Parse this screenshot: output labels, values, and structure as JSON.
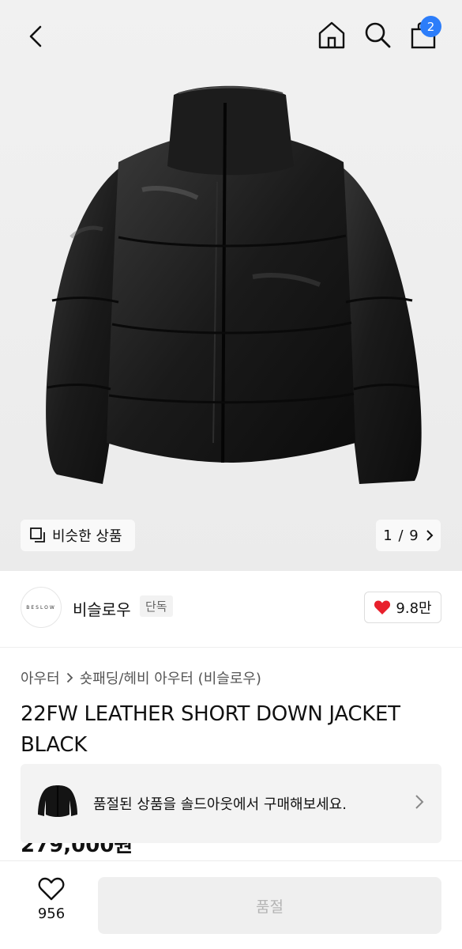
{
  "header": {
    "cart_count": "2"
  },
  "gallery": {
    "similar_label": "비슷한 상품",
    "pager": "1 / 9"
  },
  "brand": {
    "logo_text": "BESLOW",
    "name": "비슬로우",
    "tag": "단독",
    "likes": "9.8만"
  },
  "product": {
    "breadcrumb_parent": "아우터",
    "breadcrumb_child": "숏패딩/헤비 아우터 (비슬로우)",
    "title": "22FW LEATHER SHORT DOWN JACKET BLACK",
    "price": "279,000원"
  },
  "soldout_banner": {
    "text": "품절된 상품을 솔드아웃에서 구매해보세요."
  },
  "bottom": {
    "like_count": "956",
    "buy_label": "품절"
  },
  "colors": {
    "badge": "#2c7dfa",
    "heart": "#e8202c",
    "disabled_button": "#efefef"
  }
}
